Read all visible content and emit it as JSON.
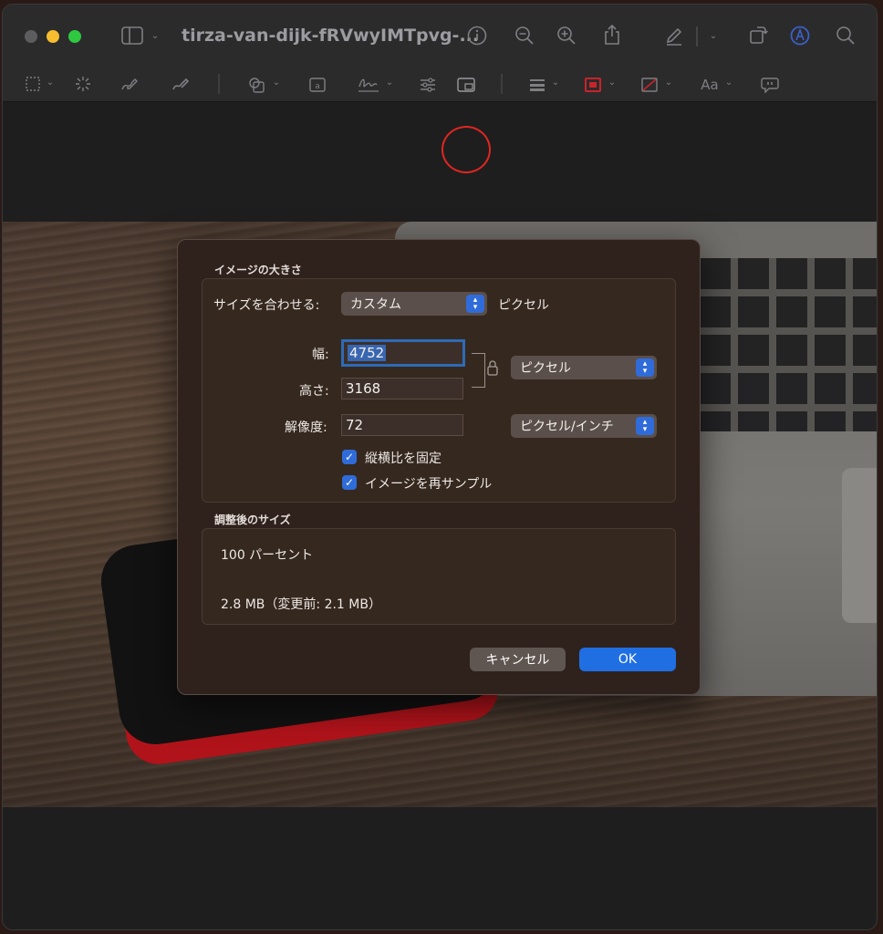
{
  "window": {
    "title": "tirza-van-dijk-fRVwyIMTpvg-..."
  },
  "toolbar": {
    "icons": [
      "sidebar-icon",
      "info-icon",
      "zoom-out-icon",
      "zoom-in-icon",
      "share-icon",
      "markup-pen-icon",
      "rotate-icon",
      "circle-a-icon",
      "search-icon"
    ],
    "tools": [
      "rect-select-icon",
      "magic-wand-icon",
      "sketch-icon",
      "draw-icon",
      "shapes-icon",
      "text-box-icon",
      "sign-icon",
      "adjust-color-icon",
      "adjust-size-icon",
      "line-style-icon",
      "border-color-icon",
      "fill-color-icon",
      "text-style-icon",
      "annotation-icon"
    ],
    "text_style_label": "Aa",
    "highlight_color": "#e0261f"
  },
  "dialog": {
    "image_size_title": "イメージの大きさ",
    "fit_label": "サイズを合わせる:",
    "fit_value": "カスタム",
    "fit_unit": "ピクセル",
    "width_label": "幅:",
    "width_value": "4752",
    "height_label": "高さ:",
    "height_value": "3168",
    "size_unit": "ピクセル",
    "resolution_label": "解像度:",
    "resolution_value": "72",
    "resolution_unit": "ピクセル/インチ",
    "keep_ratio_label": "縦横比を固定",
    "resample_label": "イメージを再サンプル",
    "result_title": "調整後のサイズ",
    "percent_text": "100 パーセント",
    "file_size_text": "2.8 MB（変更前: 2.1 MB）",
    "cancel_label": "キャンセル",
    "ok_label": "OK",
    "accent_color": "#1f6fe3"
  }
}
